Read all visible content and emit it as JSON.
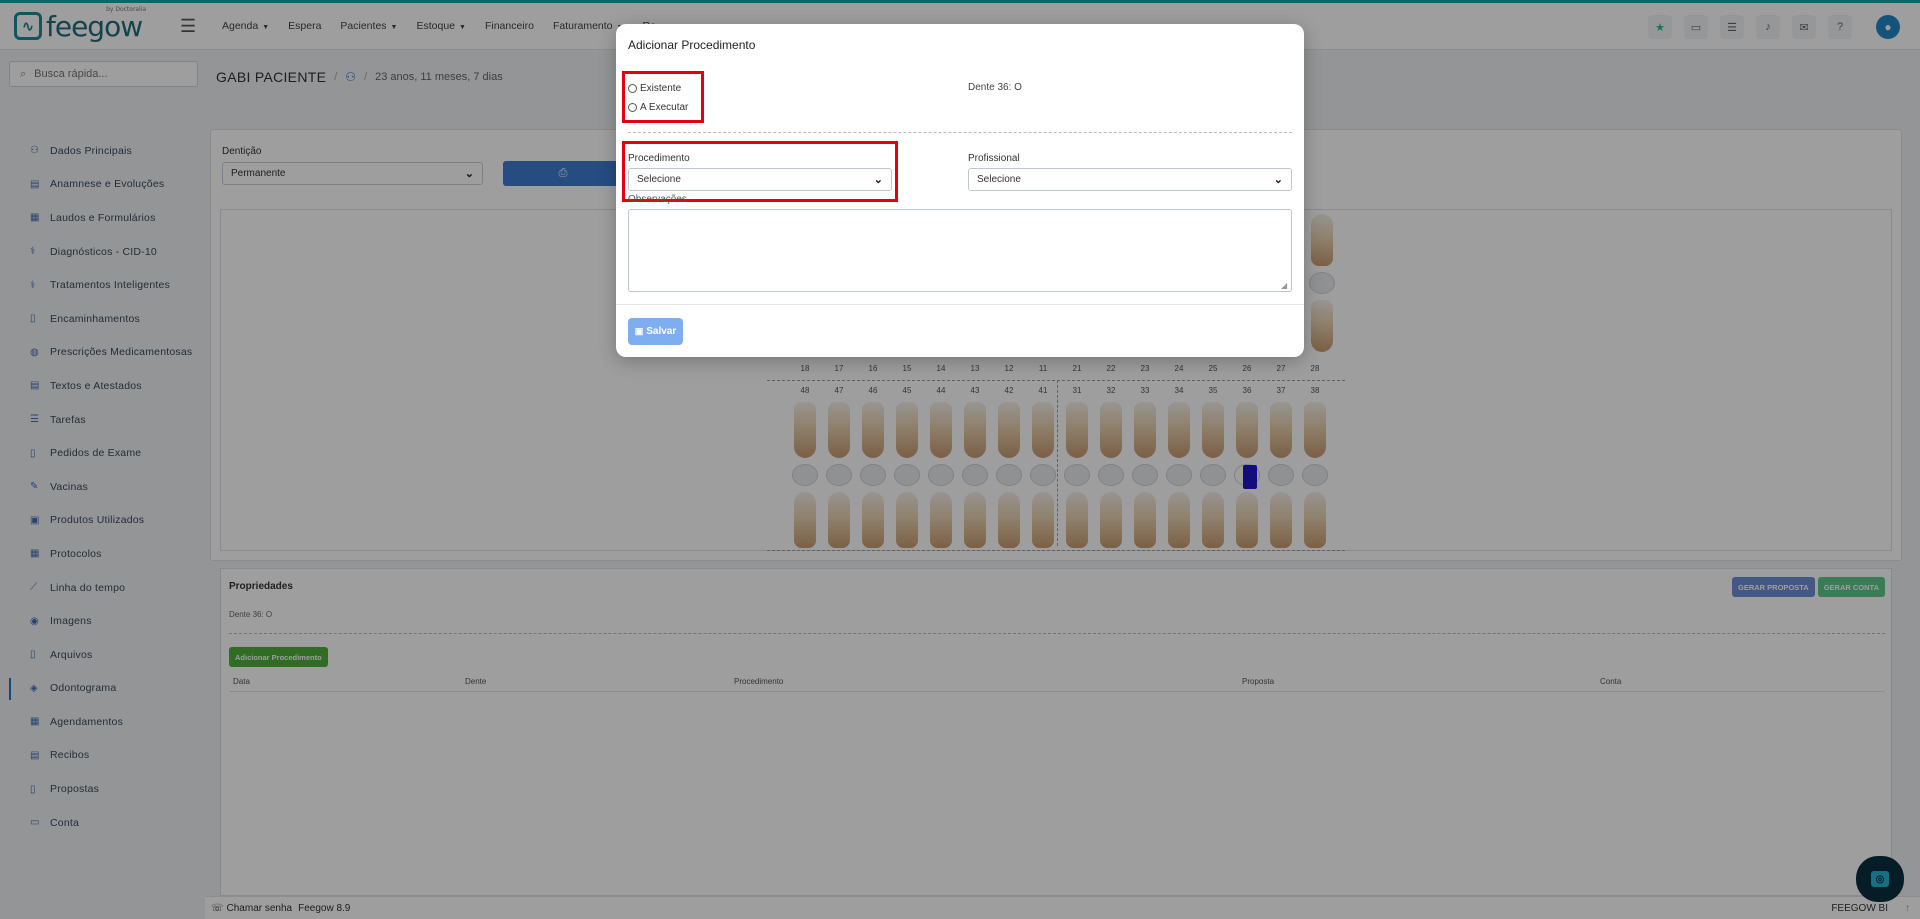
{
  "topbar": {
    "logo_text": "feegow",
    "logo_sub": "by Doctoralia",
    "nav": [
      {
        "label": "Agenda",
        "caret": true
      },
      {
        "label": "Espera",
        "caret": false
      },
      {
        "label": "Pacientes",
        "caret": true
      },
      {
        "label": "Estoque",
        "caret": true
      },
      {
        "label": "Financeiro",
        "caret": false
      },
      {
        "label": "Faturamento",
        "caret": true
      },
      {
        "label": "Re",
        "caret": false
      }
    ],
    "icons": [
      "star-icon",
      "inbox-icon",
      "tasks-icon",
      "bell-icon",
      "chat-icon",
      "help-icon"
    ]
  },
  "search": {
    "placeholder": "Busca rápida..."
  },
  "sidebar": {
    "items": [
      {
        "label": "Dados Principais",
        "icon": "user-icon"
      },
      {
        "label": "Anamnese e Evoluções",
        "icon": "chart-icon"
      },
      {
        "label": "Laudos e Formulários",
        "icon": "clipboard-icon"
      },
      {
        "label": "Diagnósticos - CID-10",
        "icon": "stethoscope-icon"
      },
      {
        "label": "Tratamentos Inteligentes",
        "icon": "stethoscope-icon"
      },
      {
        "label": "Encaminhamentos",
        "icon": "file-icon"
      },
      {
        "label": "Prescrições Medicamentosas",
        "icon": "pills-icon"
      },
      {
        "label": "Textos e Atestados",
        "icon": "file-text-icon"
      },
      {
        "label": "Tarefas",
        "icon": "list-icon"
      },
      {
        "label": "Pedidos de Exame",
        "icon": "file-icon"
      },
      {
        "label": "Vacinas",
        "icon": "syringe-icon"
      },
      {
        "label": "Produtos Utilizados",
        "icon": "box-icon"
      },
      {
        "label": "Protocolos",
        "icon": "clipboard-icon"
      },
      {
        "label": "Linha do tempo",
        "icon": "timeline-icon"
      },
      {
        "label": "Imagens",
        "icon": "camera-icon"
      },
      {
        "label": "Arquivos",
        "icon": "file-icon"
      },
      {
        "label": "Odontograma",
        "icon": "tooth-icon",
        "active": true
      },
      {
        "label": "Agendamentos",
        "icon": "calendar-icon"
      },
      {
        "label": "Recibos",
        "icon": "receipt-icon"
      },
      {
        "label": "Propostas",
        "icon": "file-icon"
      },
      {
        "label": "Conta",
        "icon": "money-icon"
      }
    ]
  },
  "patient": {
    "name": "GABI PACIENTE",
    "age": "23 anos, 11 meses, 7 dias"
  },
  "denticao": {
    "label": "Dentição",
    "value": "Permanente"
  },
  "odontogram": {
    "upper_numbers": [
      "18",
      "17",
      "16",
      "15",
      "14",
      "13",
      "12",
      "11",
      "21",
      "22",
      "23",
      "24",
      "25",
      "26",
      "27",
      "28"
    ],
    "lower_numbers": [
      "48",
      "47",
      "46",
      "45",
      "44",
      "43",
      "42",
      "41",
      "31",
      "32",
      "33",
      "34",
      "35",
      "36",
      "37",
      "38"
    ],
    "marked_tooth": "36",
    "mark_color": "#1e14c8"
  },
  "properties": {
    "title": "Propriedades",
    "dente": "Dente 36: O",
    "btn_proposta": "GERAR PROPOSTA",
    "btn_conta": "GERAR CONTA",
    "btn_add": "Adicionar Procedimento",
    "columns": [
      "Data",
      "Dente",
      "Procedimento",
      "Proposta",
      "Conta"
    ]
  },
  "footer": {
    "chamar": "Chamar senha",
    "version": "Feegow 8.9",
    "bi": "FEEGOW BI"
  },
  "modal": {
    "title": "Adicionar Procedimento",
    "radio_existente": "Existente",
    "radio_executar": "A Executar",
    "dente_info": "Dente 36: O",
    "procedimento_label": "Procedimento",
    "procedimento_value": "Selecione",
    "profissional_label": "Profissional",
    "profissional_value": "Selecione",
    "observacoes_label": "Observações",
    "save_label": "Salvar"
  },
  "colors": {
    "accent": "#3e7bd0",
    "highlight": "#e5000f",
    "success": "#4cae3a"
  }
}
